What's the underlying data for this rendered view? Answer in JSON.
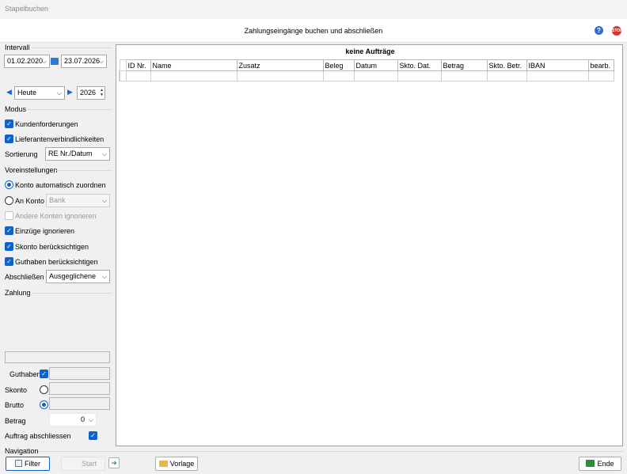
{
  "window": {
    "title": "Stapelbuchen"
  },
  "header": {
    "subtitle": "Zahlungseingänge buchen und abschließen",
    "help_icon": "help-icon",
    "close_icon": "stop-icon"
  },
  "intervall": {
    "label": "Intervall",
    "from_date": "01.02.2020",
    "to_date": "23.07.2026",
    "period": "Heute",
    "year": "2026"
  },
  "modus": {
    "label": "Modus",
    "kundenforderungen": "Kundenforderungen",
    "lieferanten": "Lieferantenverbindlichkeiten",
    "sortierung_label": "Sortierung",
    "sortierung_value": "RE Nr./Datum"
  },
  "voreinstellungen": {
    "label": "Voreinstellungen",
    "konto_auto": "Konto automatisch zuordnen",
    "an_konto": "An Konto",
    "an_konto_value": "Bank",
    "andere_konten": "Andere Konten ignorieren",
    "einzuege": "Einzüge ignorieren",
    "skonto": "Skonto berücksichtigen",
    "guthaben": "Guthaben berücksichtigen",
    "abschliessen_label": "Abschließen",
    "abschliessen_value": "Ausgeglichene"
  },
  "zahlung": {
    "label": "Zahlung",
    "guthaben": "Guthaben",
    "skonto": "Skonto",
    "brutto": "Brutto",
    "betrag": "Betrag",
    "betrag_value": "0",
    "auftrag_abschliessen": "Auftrag abschliessen"
  },
  "grid": {
    "title": "keine Aufträge",
    "columns": [
      "ID Nr.",
      "Name",
      "Zusatz",
      "Beleg",
      "Datum",
      "Skto. Dat.",
      "Betrag",
      "Skto. Betr.",
      "IBAN",
      "bearb."
    ]
  },
  "navigation": {
    "label": "Navigation",
    "filter": "Filter",
    "start": "Start",
    "vorlage": "Vorlage",
    "ende": "Ende"
  }
}
